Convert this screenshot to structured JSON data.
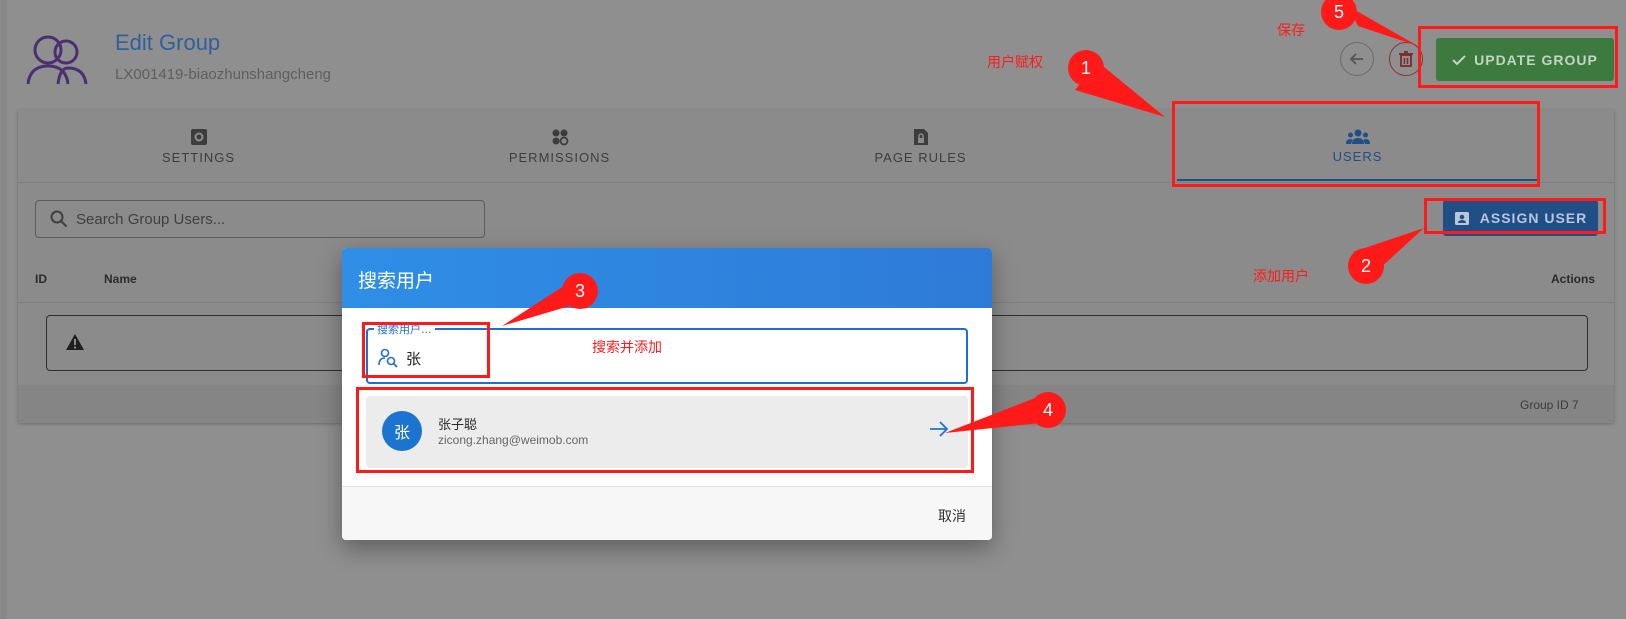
{
  "header": {
    "title": "Edit Group",
    "subtitle": "LX001419-biaozhunshangcheng",
    "update_label": "UPDATE GROUP"
  },
  "tabs": [
    {
      "label": "SETTINGS",
      "icon": "gear-icon"
    },
    {
      "label": "PERMISSIONS",
      "icon": "permissions-icon"
    },
    {
      "label": "PAGE RULES",
      "icon": "page-lock-icon"
    },
    {
      "label": "USERS",
      "icon": "users-icon",
      "active": true
    }
  ],
  "users_tab": {
    "search_placeholder": "Search Group Users...",
    "assign_label": "ASSIGN USER",
    "columns": [
      "ID",
      "Name",
      "Actions"
    ],
    "footer": "Group ID 7"
  },
  "dialog": {
    "title": "搜索用户",
    "field_label": "搜索用户...",
    "field_value": "张",
    "result": {
      "avatar_text": "张",
      "name": "张子聪",
      "email": "zicong.zhang@weimob.com"
    },
    "cancel_label": "取消"
  },
  "annotations": {
    "save": "保存",
    "user_auth": "用户赋权",
    "add_user": "添加用户",
    "search_add": "搜索并添加",
    "badges": [
      "1",
      "2",
      "3",
      "4",
      "5"
    ]
  },
  "colors": {
    "accent_blue": "#2f8ee6",
    "update_green": "#3d7a3f",
    "annotation_red": "#ff1a1a"
  }
}
